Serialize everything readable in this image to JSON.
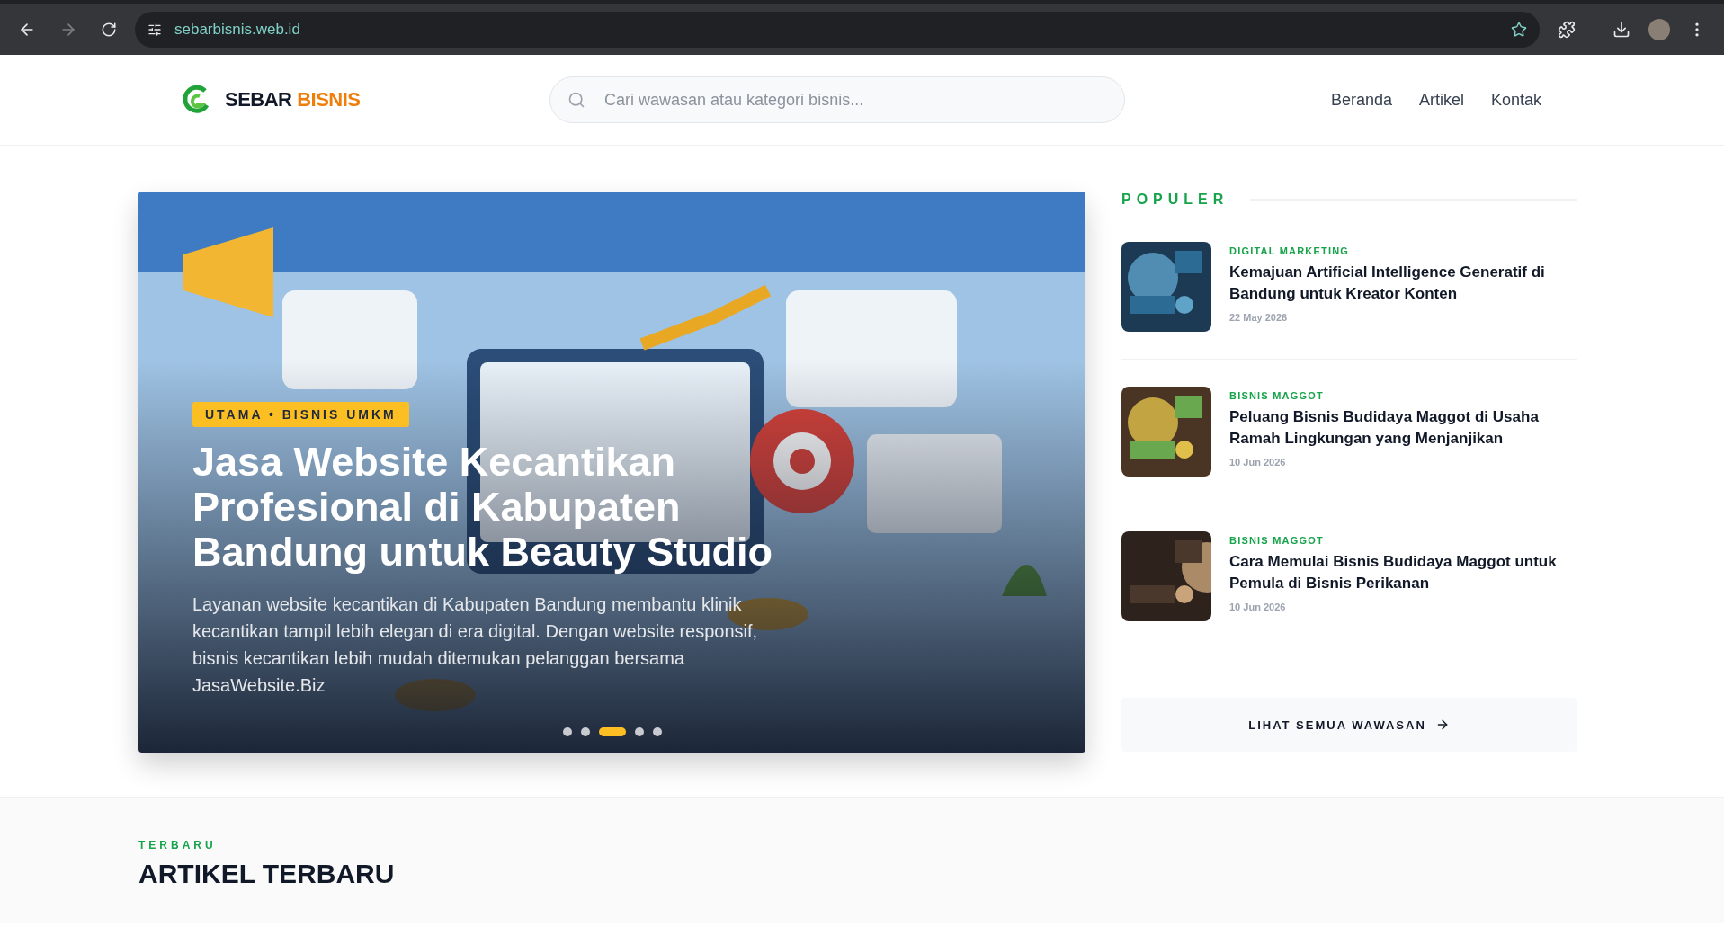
{
  "browser": {
    "url": "sebarbisnis.web.id",
    "forward_disabled": true,
    "bookmarked": false
  },
  "header": {
    "logo": {
      "first": "SEBAR",
      "second": "BISNIS"
    },
    "search": {
      "placeholder": "Cari wawasan atau kategori bisnis..."
    },
    "nav": [
      {
        "label": "Beranda"
      },
      {
        "label": "Artikel"
      },
      {
        "label": "Kontak"
      }
    ]
  },
  "hero": {
    "badge": "UTAMA • BISNIS UMKM",
    "title": "Jasa Website Kecantikan Profesional di Kabupaten Bandung untuk Beauty Studio",
    "summary": "Layanan website kecantikan di Kabupaten Bandung membantu klinik kecantikan tampil lebih elegan di era digital. Dengan website responsif, bisnis kecantikan lebih mudah ditemukan pelanggan bersama JasaWebsite.Biz",
    "dots": [
      {
        "selected": false
      },
      {
        "selected": false
      },
      {
        "selected": true
      },
      {
        "selected": false
      },
      {
        "selected": false
      }
    ]
  },
  "popular": {
    "heading": "POPULER",
    "items": [
      {
        "category": "DIGITAL MARKETING",
        "title": "Kemajuan Artificial Intelligence Generatif di Bandung untuk Kreator Konten",
        "date": "22 May 2026",
        "kind": "picture"
      },
      {
        "category": "BISNIS MAGGOT",
        "title": "Peluang Bisnis Budidaya Maggot di Usaha Ramah Lingkungan yang Menjanjikan",
        "date": "10 Jun 2026",
        "kind": "picture"
      },
      {
        "category": "BISNIS MAGGOT",
        "title": "Cara Memulai Bisnis Budidaya Maggot untuk Pemula di Bisnis Perikanan",
        "date": "10 Jun 2026",
        "kind": "picture"
      }
    ],
    "button": "LIHAT SEMUA WAWASAN"
  },
  "latest": {
    "eyebrow": "TERBARU",
    "heading": "ARTIKEL TERBARU"
  }
}
